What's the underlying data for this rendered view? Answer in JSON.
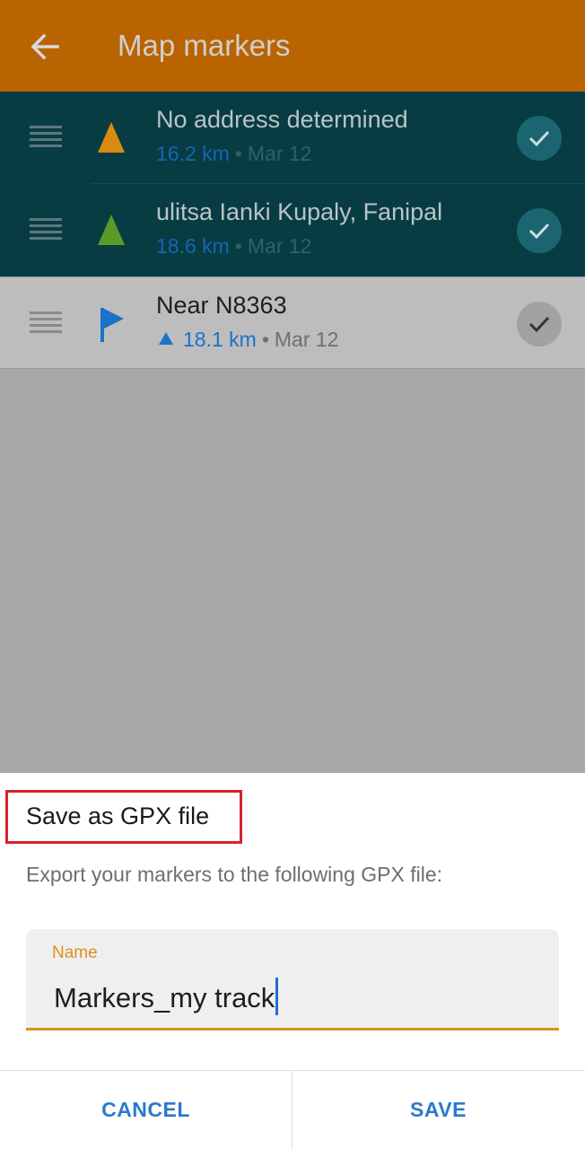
{
  "appbar": {
    "title": "Map markers",
    "back_icon": "arrow-back-icon"
  },
  "markers": [
    {
      "title": "No address determined",
      "distance": "16.2 km",
      "separator": "•",
      "date": "Mar 12",
      "icon": "navigation-arrow-icon",
      "icon_color": "#d98a10",
      "state": "active"
    },
    {
      "title": "ulitsa Ianki Kupaly, Fanipal",
      "distance": "18.6 km",
      "separator": "•",
      "date": "Mar 12",
      "icon": "navigation-arrow-icon",
      "icon_color": "#5a9a26",
      "state": "active"
    },
    {
      "title": "Near N8363",
      "distance": "18.1 km",
      "separator": "•",
      "date": "Mar 12",
      "icon": "flag-icon",
      "icon_color": "#1a72c9",
      "state": "passed"
    }
  ],
  "dialog": {
    "title": "Save as GPX file",
    "description": "Export your markers to the following GPX file:",
    "field_label": "Name",
    "field_value": "Markers_my track",
    "cancel_label": "CANCEL",
    "save_label": "SAVE"
  },
  "colors": {
    "appbar": "#b96400",
    "accent": "#e0901c",
    "button_text": "#2b7acb",
    "highlight_box": "#d8222f"
  }
}
